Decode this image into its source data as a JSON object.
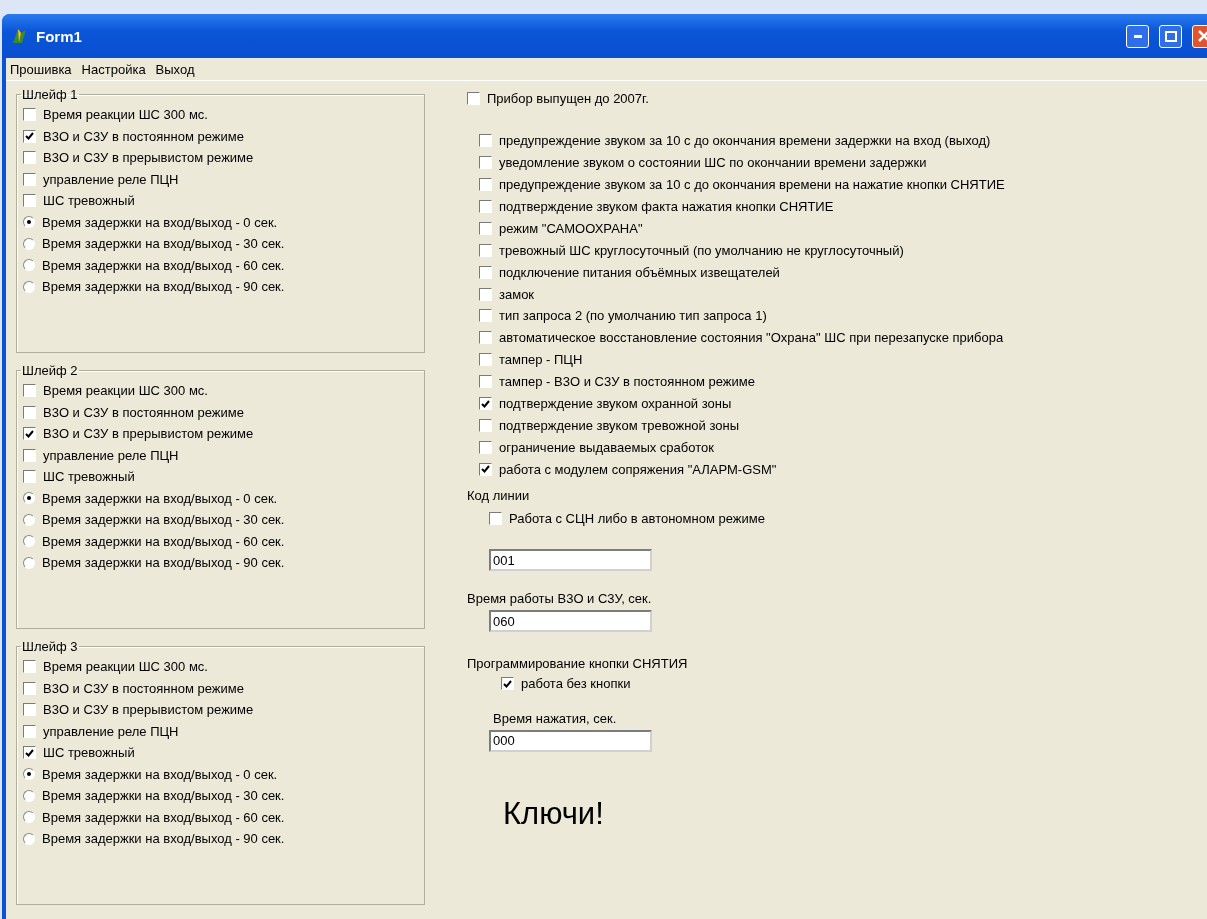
{
  "window": {
    "title": "Form1"
  },
  "menu": [
    "Прошивка",
    "Настройка",
    "Выход"
  ],
  "groups": [
    {
      "title": "Шлейф 1",
      "options": [
        {
          "kind": "checkbox",
          "label": "Время реакции ШС 300 мс.",
          "checked": false
        },
        {
          "kind": "checkbox",
          "label": "В3О и С3У в постоянном режиме",
          "checked": true
        },
        {
          "kind": "checkbox",
          "label": "В3О и С3У в прерывистом режиме",
          "checked": false
        },
        {
          "kind": "checkbox",
          "label": "управление реле ПЦН",
          "checked": false
        },
        {
          "kind": "checkbox",
          "label": "ШС тревожный",
          "checked": false
        },
        {
          "kind": "radio",
          "label": "Время задержки на вход/выход -  0 сек.",
          "selected": true
        },
        {
          "kind": "radio",
          "label": "Время задержки на вход/выход - 30 сек.",
          "selected": false
        },
        {
          "kind": "radio",
          "label": "Время задержки на вход/выход - 60 сек.",
          "selected": false
        },
        {
          "kind": "radio",
          "label": "Время задержки на вход/выход - 90 сек.",
          "selected": false
        }
      ]
    },
    {
      "title": "Шлейф 2",
      "options": [
        {
          "kind": "checkbox",
          "label": "Время реакции ШС 300 мс.",
          "checked": false
        },
        {
          "kind": "checkbox",
          "label": "В3О и С3У в постоянном режиме",
          "checked": false
        },
        {
          "kind": "checkbox",
          "label": "В3О и С3У в прерывистом режиме",
          "checked": true
        },
        {
          "kind": "checkbox",
          "label": "управление реле ПЦН",
          "checked": false
        },
        {
          "kind": "checkbox",
          "label": "ШС тревожный",
          "checked": false
        },
        {
          "kind": "radio",
          "label": "Время задержки на вход/выход -  0 сек.",
          "selected": true
        },
        {
          "kind": "radio",
          "label": "Время задержки на вход/выход - 30 сек.",
          "selected": false
        },
        {
          "kind": "radio",
          "label": "Время задержки на вход/выход - 60 сек.",
          "selected": false
        },
        {
          "kind": "radio",
          "label": "Время задержки на вход/выход - 90 сек.",
          "selected": false
        }
      ]
    },
    {
      "title": "Шлейф 3",
      "options": [
        {
          "kind": "checkbox",
          "label": "Время реакции ШС 300 мс.",
          "checked": false
        },
        {
          "kind": "checkbox",
          "label": "В3О и С3У в постоянном режиме",
          "checked": false
        },
        {
          "kind": "checkbox",
          "label": "В3О и С3У в прерывистом режиме",
          "checked": false
        },
        {
          "kind": "checkbox",
          "label": "управление реле ПЦН",
          "checked": false
        },
        {
          "kind": "checkbox",
          "label": "ШС тревожный",
          "checked": true
        },
        {
          "kind": "radio",
          "label": "Время задержки на вход/выход -  0 сек.",
          "selected": true
        },
        {
          "kind": "radio",
          "label": "Время задержки на вход/выход - 30 сек.",
          "selected": false
        },
        {
          "kind": "radio",
          "label": "Время задержки на вход/выход - 60 сек.",
          "selected": false
        },
        {
          "kind": "radio",
          "label": "Время задержки на вход/выход - 90 сек.",
          "selected": false
        }
      ]
    }
  ],
  "device_old": {
    "label": "Прибор выпущен до 2007г.",
    "checked": false
  },
  "options": [
    {
      "label": "предупреждение звуком за 10 с до окончания времени задержки на вход (выход)",
      "checked": false
    },
    {
      "label": "уведомление звуком о состоянии ШС по окончании времени задержки",
      "checked": false
    },
    {
      "label": "предупреждение звуком за 10 с до окончания времени на нажатие кнопки СНЯТИЕ",
      "checked": false
    },
    {
      "label": "подтверждение звуком факта нажатия кнопки СНЯТИЕ",
      "checked": false
    },
    {
      "label": "режим \"САМООХРАНА\"",
      "checked": false
    },
    {
      "label": "тревожный ШС круглосуточный (по умолчанию не  круглосуточный)",
      "checked": false
    },
    {
      "label": "подключение питания объёмных извещателей",
      "checked": false
    },
    {
      "label": "замок",
      "checked": false
    },
    {
      "label": "тип запроса 2 (по умолчанию тип запроса 1)",
      "checked": false
    },
    {
      "label": "автоматическое восстановление состояния \"Охрана\"  ШС при перезапуске прибора",
      "checked": false
    },
    {
      "label": "тампер - ПЦН",
      "checked": false
    },
    {
      "label": "тампер - В3О и С3У в постоянном режиме",
      "checked": false
    },
    {
      "label": "подтверждение звуком охранной зоны",
      "checked": true
    },
    {
      "label": "подтверждение звуком тревожной зоны",
      "checked": false
    },
    {
      "label": "ограничение выдаваемых сработок",
      "checked": false
    },
    {
      "label": "работа с модулем сопряжения \"АЛАРМ-GSM\"",
      "checked": true
    }
  ],
  "line_code": {
    "label": "Код линии",
    "checkbox": {
      "label": "Работа с СЦН либо в автономном режиме",
      "checked": false
    },
    "value": "001"
  },
  "work_time": {
    "label": "Время работы В3О и С3У, сек.",
    "value": "060"
  },
  "button_programming": {
    "label": "Программирование кнопки СНЯТИЯ",
    "checkbox": {
      "label": "работа без кнопки",
      "checked": true
    },
    "time_label": "Время нажатия, сек.",
    "value": "000"
  },
  "keys_label": "Ключи!"
}
